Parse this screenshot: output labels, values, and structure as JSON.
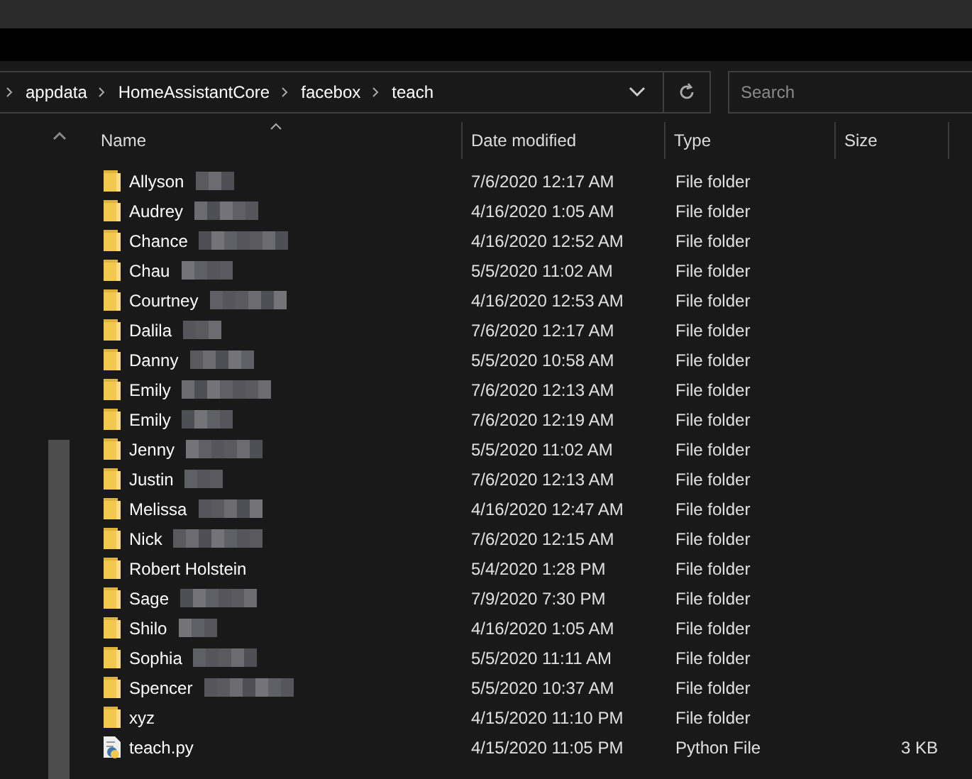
{
  "breadcrumb": [
    "appdata",
    "HomeAssistantCore",
    "facebox",
    "teach"
  ],
  "search": {
    "placeholder": "Search"
  },
  "columns": [
    {
      "label": "Name",
      "sorted": true
    },
    {
      "label": "Date modified",
      "sorted": false
    },
    {
      "label": "Type",
      "sorted": false
    },
    {
      "label": "Size",
      "sorted": false
    }
  ],
  "files": [
    {
      "kind": "folder",
      "name": "Allyson",
      "redacted": true,
      "date": "7/6/2020 12:17 AM",
      "type": "File folder"
    },
    {
      "kind": "folder",
      "name": "Audrey",
      "redacted": true,
      "date": "4/16/2020 1:05 AM",
      "type": "File folder"
    },
    {
      "kind": "folder",
      "name": "Chance",
      "redacted": true,
      "date": "4/16/2020 12:52 AM",
      "type": "File folder"
    },
    {
      "kind": "folder",
      "name": "Chau",
      "redacted": true,
      "date": "5/5/2020 11:02 AM",
      "type": "File folder"
    },
    {
      "kind": "folder",
      "name": "Courtney",
      "redacted": true,
      "date": "4/16/2020 12:53 AM",
      "type": "File folder"
    },
    {
      "kind": "folder",
      "name": "Dalila",
      "redacted": true,
      "date": "7/6/2020 12:17 AM",
      "type": "File folder"
    },
    {
      "kind": "folder",
      "name": "Danny",
      "redacted": true,
      "date": "5/5/2020 10:58 AM",
      "type": "File folder"
    },
    {
      "kind": "folder",
      "name": "Emily",
      "redacted": true,
      "date": "7/6/2020 12:13 AM",
      "type": "File folder"
    },
    {
      "kind": "folder",
      "name": "Emily",
      "redacted": true,
      "date": "7/6/2020 12:19 AM",
      "type": "File folder"
    },
    {
      "kind": "folder",
      "name": "Jenny",
      "redacted": true,
      "date": "5/5/2020 11:02 AM",
      "type": "File folder"
    },
    {
      "kind": "folder",
      "name": "Justin",
      "redacted": true,
      "date": "7/6/2020 12:13 AM",
      "type": "File folder"
    },
    {
      "kind": "folder",
      "name": "Melissa",
      "redacted": true,
      "date": "4/16/2020 12:47 AM",
      "type": "File folder"
    },
    {
      "kind": "folder",
      "name": "Nick",
      "redacted": true,
      "date": "7/6/2020 12:15 AM",
      "type": "File folder"
    },
    {
      "kind": "folder",
      "name": "Robert Holstein",
      "redacted": false,
      "date": "5/4/2020 1:28 PM",
      "type": "File folder"
    },
    {
      "kind": "folder",
      "name": "Sage",
      "redacted": true,
      "date": "7/9/2020 7:30 PM",
      "type": "File folder"
    },
    {
      "kind": "folder",
      "name": "Shilo",
      "redacted": true,
      "date": "4/16/2020 1:05 AM",
      "type": "File folder"
    },
    {
      "kind": "folder",
      "name": "Sophia",
      "redacted": true,
      "date": "5/5/2020 11:11 AM",
      "type": "File folder"
    },
    {
      "kind": "folder",
      "name": "Spencer",
      "redacted": true,
      "date": "5/5/2020 10:37 AM",
      "type": "File folder"
    },
    {
      "kind": "folder",
      "name": "xyz",
      "redacted": false,
      "date": "4/15/2020 11:10 PM",
      "type": "File folder"
    },
    {
      "kind": "python",
      "name": "teach.py",
      "redacted": false,
      "date": "4/15/2020 11:05 PM",
      "type": "Python File",
      "size": "3 KB"
    }
  ]
}
